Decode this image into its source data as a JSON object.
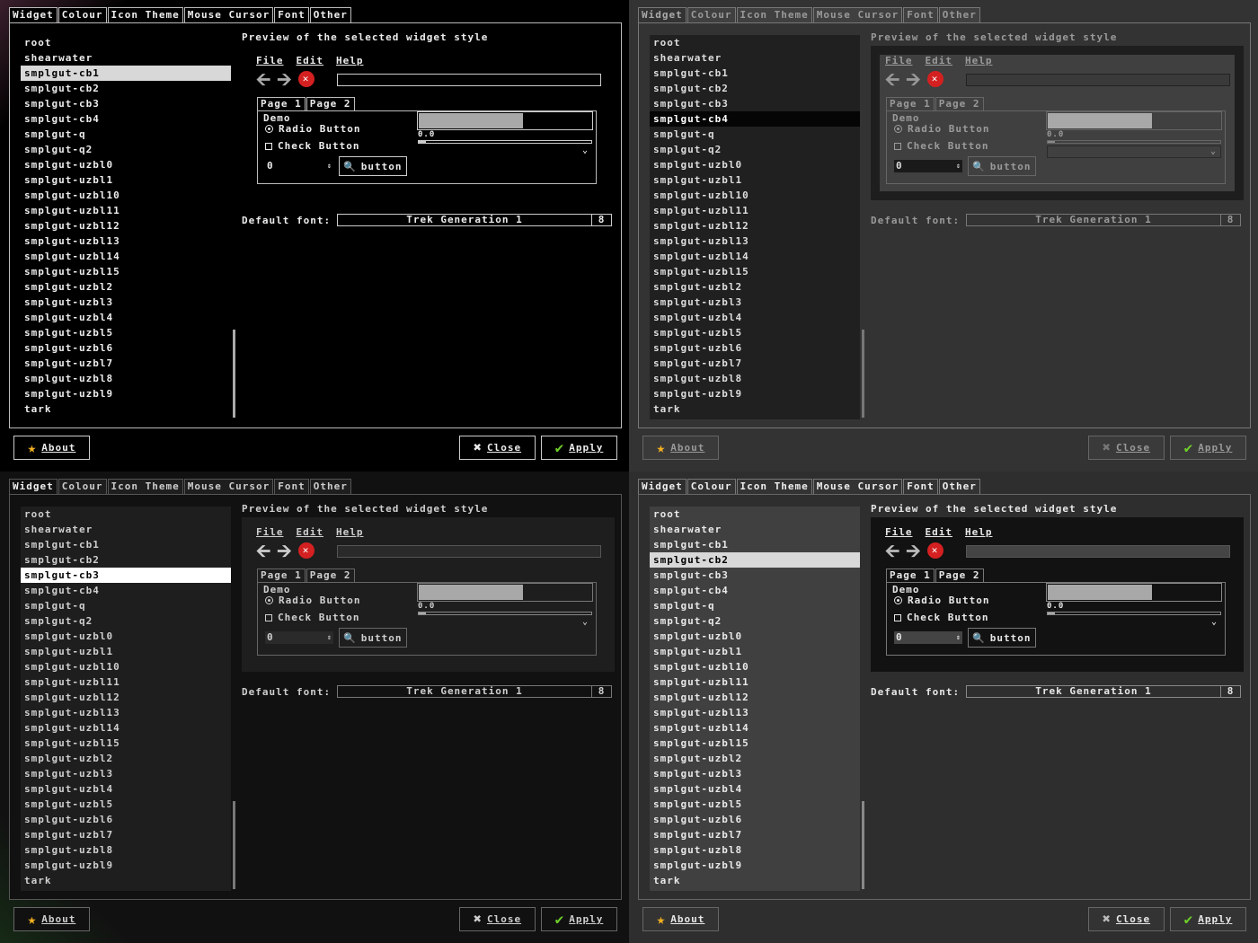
{
  "tabs": [
    "Widget",
    "Colour",
    "Icon Theme",
    "Mouse Cursor",
    "Font",
    "Other"
  ],
  "themes": [
    "root",
    "shearwater",
    "smplgut-cb1",
    "smplgut-cb2",
    "smplgut-cb3",
    "smplgut-cb4",
    "smplgut-q",
    "smplgut-q2",
    "smplgut-uzbl0",
    "smplgut-uzbl1",
    "smplgut-uzbl10",
    "smplgut-uzbl11",
    "smplgut-uzbl12",
    "smplgut-uzbl13",
    "smplgut-uzbl14",
    "smplgut-uzbl15",
    "smplgut-uzbl2",
    "smplgut-uzbl3",
    "smplgut-uzbl4",
    "smplgut-uzbl5",
    "smplgut-uzbl6",
    "smplgut-uzbl7",
    "smplgut-uzbl8",
    "smplgut-uzbl9",
    "tark"
  ],
  "selected_index": [
    2,
    5,
    4,
    3
  ],
  "preview": {
    "title": "Preview of the selected widget style",
    "menu_file": "File",
    "menu_edit": "Edit",
    "menu_help": "Help",
    "tab_page1": "Page 1",
    "tab_page2": "Page 2",
    "demo_label": "Demo",
    "radio_label": "Radio Button",
    "check_label": "Check Button",
    "spin_value": "0",
    "button_label": "button",
    "progress_text": "0.0",
    "progress_fraction": 0.6
  },
  "font": {
    "label": "Default font:",
    "name": "Trek Generation 1",
    "size": "8"
  },
  "buttons": {
    "about": "About",
    "close": "Close",
    "apply": "Apply"
  },
  "colors": {
    "stop_icon": "#d42020",
    "star_icon": "#f2b020",
    "check_icon": "#6ecf2a"
  }
}
